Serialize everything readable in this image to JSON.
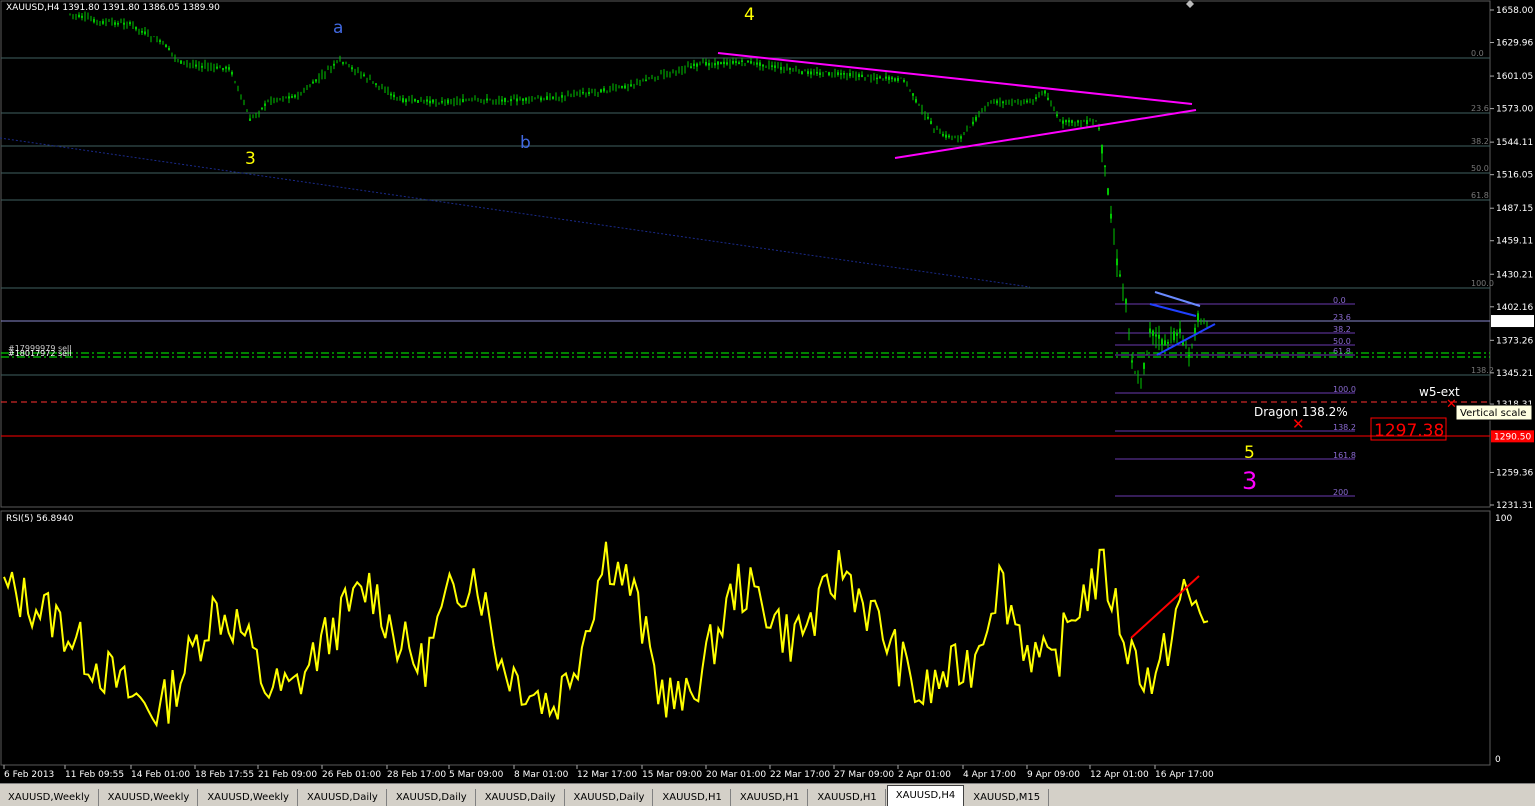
{
  "window": {
    "symbol_caption": "XAUUSD,H4  1391.80 1391.80 1386.05 1389.90",
    "indicator_caption": "RSI(5) 56.8940"
  },
  "colors": {
    "background": "#000000",
    "candle_up": "#00c800",
    "grid": "#4a4a4a",
    "rsi_line": "#ffff00",
    "triangle": "#ff00ff",
    "label_yellow": "#ffff00",
    "label_blue": "#4169e1",
    "label_magenta": "#ff00ff",
    "target_red": "#ff0000"
  },
  "price_axis": {
    "labels": [
      "1658.00",
      "1629.96",
      "1601.05",
      "1573.00",
      "1544.11",
      "1516.05",
      "1487.15",
      "1459.11",
      "1430.21",
      "1402.16",
      "1389.90",
      "1373.26",
      "1345.21",
      "1318.31",
      "1290.50",
      "1259.36",
      "1231.31"
    ],
    "current_price": "1389.90",
    "target_price_tag": "1290.50"
  },
  "rsi_axis": {
    "labels": [
      "100",
      "0"
    ]
  },
  "time_axis": {
    "labels": [
      "6 Feb 2013",
      "11 Feb 09:55",
      "14 Feb 01:00",
      "18 Feb 17:55",
      "21 Feb 09:00",
      "26 Feb 01:00",
      "28 Feb 17:00",
      "5 Mar 09:00",
      "8 Mar 01:00",
      "12 Mar 17:00",
      "15 Mar 09:00",
      "20 Mar 01:00",
      "22 Mar 17:00",
      "27 Mar 09:00",
      "2 Apr 01:00",
      "4 Apr 17:00",
      "9 Apr 09:00",
      "12 Apr 01:00",
      "16 Apr 17:00"
    ]
  },
  "fib_levels_left": [
    "0.0",
    "23.6",
    "38.2",
    "50.0",
    "61.8",
    "100.0",
    "138.2"
  ],
  "fib_levels_right": [
    "0.0",
    "23.6",
    "38.2",
    "50.0",
    "61.8",
    "100.0",
    "138.2",
    "161.8",
    "200"
  ],
  "orders": [
    "#17999979 sell",
    "#18017972 sell"
  ],
  "wave_labels": {
    "w3_yellow": "3",
    "a_blue": "a",
    "b_blue": "b",
    "w4_yellow": "4",
    "w5_yellow": "5",
    "w3_magenta": "3"
  },
  "annotations": {
    "dragon": "Dragon 138.2%",
    "w5_ext": "w5-ext",
    "target_box": "1297.38",
    "tooltip": "Vertical scale"
  },
  "tabs": [
    {
      "label": "XAUUSD,Weekly",
      "active": false
    },
    {
      "label": "XAUUSD,Weekly",
      "active": false
    },
    {
      "label": "XAUUSD,Weekly",
      "active": false
    },
    {
      "label": "XAUUSD,Daily",
      "active": false
    },
    {
      "label": "XAUUSD,Daily",
      "active": false
    },
    {
      "label": "XAUUSD,Daily",
      "active": false
    },
    {
      "label": "XAUUSD,Daily",
      "active": false
    },
    {
      "label": "XAUUSD,H1",
      "active": false
    },
    {
      "label": "XAUUSD,H1",
      "active": false
    },
    {
      "label": "XAUUSD,H1",
      "active": false
    },
    {
      "label": "XAUUSD,H4",
      "active": true
    },
    {
      "label": "XAUUSD,M15",
      "active": false
    }
  ],
  "chart_data": [
    {
      "type": "line",
      "title": "XAUUSD,H4",
      "ylim": [
        1231.31,
        1658.0
      ],
      "series": [
        {
          "name": "XAUUSD,H4",
          "x": [
            "6 Feb 2013",
            "11 Feb 09:55",
            "14 Feb 01:00",
            "18 Feb 17:55",
            "21 Feb 09:00",
            "26 Feb 01:00",
            "28 Feb 17:00",
            "5 Mar 09:00",
            "8 Mar 01:00",
            "12 Mar 17:00",
            "15 Mar 09:00",
            "20 Mar 01:00",
            "22 Mar 17:00",
            "27 Mar 09:00",
            "2 Apr 01:00",
            "4 Apr 17:00",
            "9 Apr 09:00",
            "12 Apr 01:00",
            "16 Apr 17:00"
          ],
          "values": [
            1668,
            1650,
            1640,
            1618,
            1580,
            1612,
            1590,
            1585,
            1582,
            1598,
            1608,
            1615,
            1610,
            1605,
            1575,
            1582,
            1585,
            1475,
            1389.9
          ]
        }
      ],
      "annotations": [
        "3",
        "a",
        "b",
        "4",
        "5",
        "3",
        "Dragon 138.2%",
        "w5-ext",
        "1297.38"
      ]
    },
    {
      "type": "line",
      "title": "RSI(5) 56.8940",
      "ylim": [
        0,
        100
      ],
      "series": [
        {
          "name": "RSI(5)",
          "values": [
            70,
            65,
            58,
            45,
            35,
            25,
            20,
            40,
            62,
            55,
            30,
            28,
            45,
            60,
            72,
            50,
            38,
            66,
            78,
            40,
            30,
            22,
            45,
            85,
            70,
            30,
            22,
            45,
            72,
            65,
            50,
            58,
            80,
            62,
            45,
            25,
            35,
            40,
            75,
            48,
            36,
            64,
            78,
            45,
            30,
            68,
            56.894
          ]
        }
      ]
    }
  ]
}
